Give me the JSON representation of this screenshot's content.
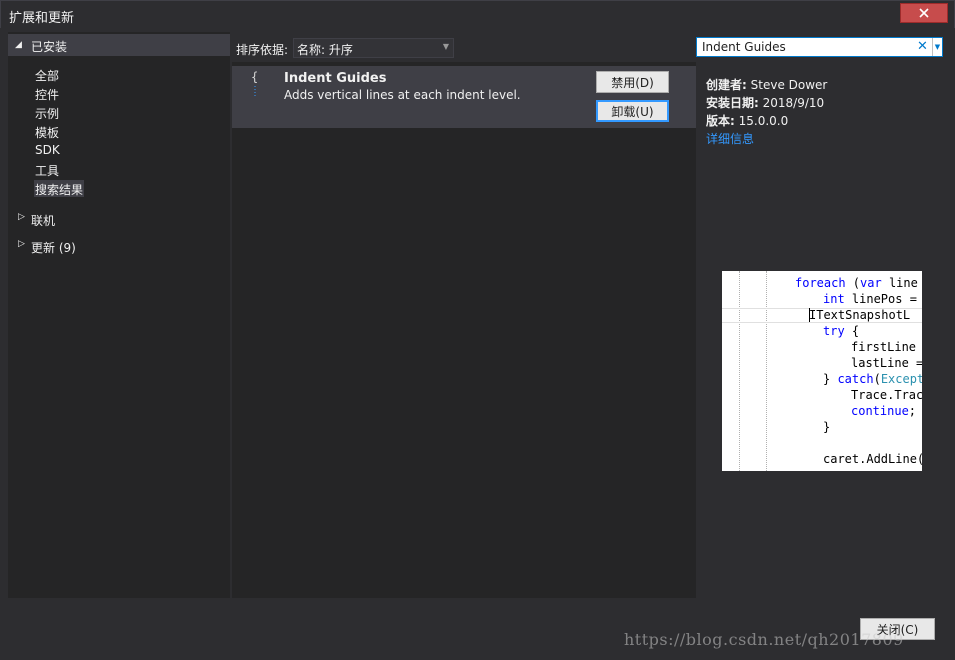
{
  "window": {
    "title": "扩展和更新",
    "close_icon": "close-x-icon"
  },
  "tree": {
    "installed": {
      "label": "已安装",
      "children": [
        "全部",
        "控件",
        "示例",
        "模板",
        "SDK",
        "工具",
        "搜索结果"
      ],
      "selected": "搜索结果"
    },
    "online": {
      "label": "联机"
    },
    "updates": {
      "label": "更新 (9)"
    }
  },
  "sort": {
    "label": "排序依据:",
    "value": "名称: 升序"
  },
  "search": {
    "value": "Indent Guides"
  },
  "extension": {
    "name": "Indent Guides",
    "description": "Adds vertical lines at each indent level.",
    "disable_label": "禁用(D)",
    "uninstall_label": "卸载(U)"
  },
  "details": {
    "creator_key": "创建者:",
    "creator": "Steve Dower",
    "date_key": "安装日期:",
    "date": "2018/9/10",
    "version_key": "版本:",
    "version": "15.0.0.0",
    "more_link": "详细信息"
  },
  "preview_code": [
    [
      "kw:foreach",
      "tx: (",
      "kw:var",
      "tx: line"
    ],
    [
      "kw:int",
      "tx: linePos ="
    ],
    [
      "tx:ITextSnapshotL"
    ],
    [
      "kw:try",
      "tx: {"
    ],
    [
      "tx:firstLine"
    ],
    [
      "tx:lastLine ="
    ],
    [
      "tx:} ",
      "kw:catch",
      "tx:(",
      "ty:Except"
    ],
    [
      "tx:Trace.Trac"
    ],
    [
      "kw:continue",
      "tx:;"
    ],
    [
      "tx:}"
    ],
    [
      "tx:"
    ],
    [
      "tx:caret.AddLine("
    ]
  ],
  "footer": {
    "close_label": "关闭(C)"
  },
  "watermark": "https://blog.csdn.net/qh2017809",
  "colors": {
    "accent": "#007acc",
    "link": "#3399ff",
    "close_red": "#c74c4c",
    "bg": "#2d2d30"
  }
}
